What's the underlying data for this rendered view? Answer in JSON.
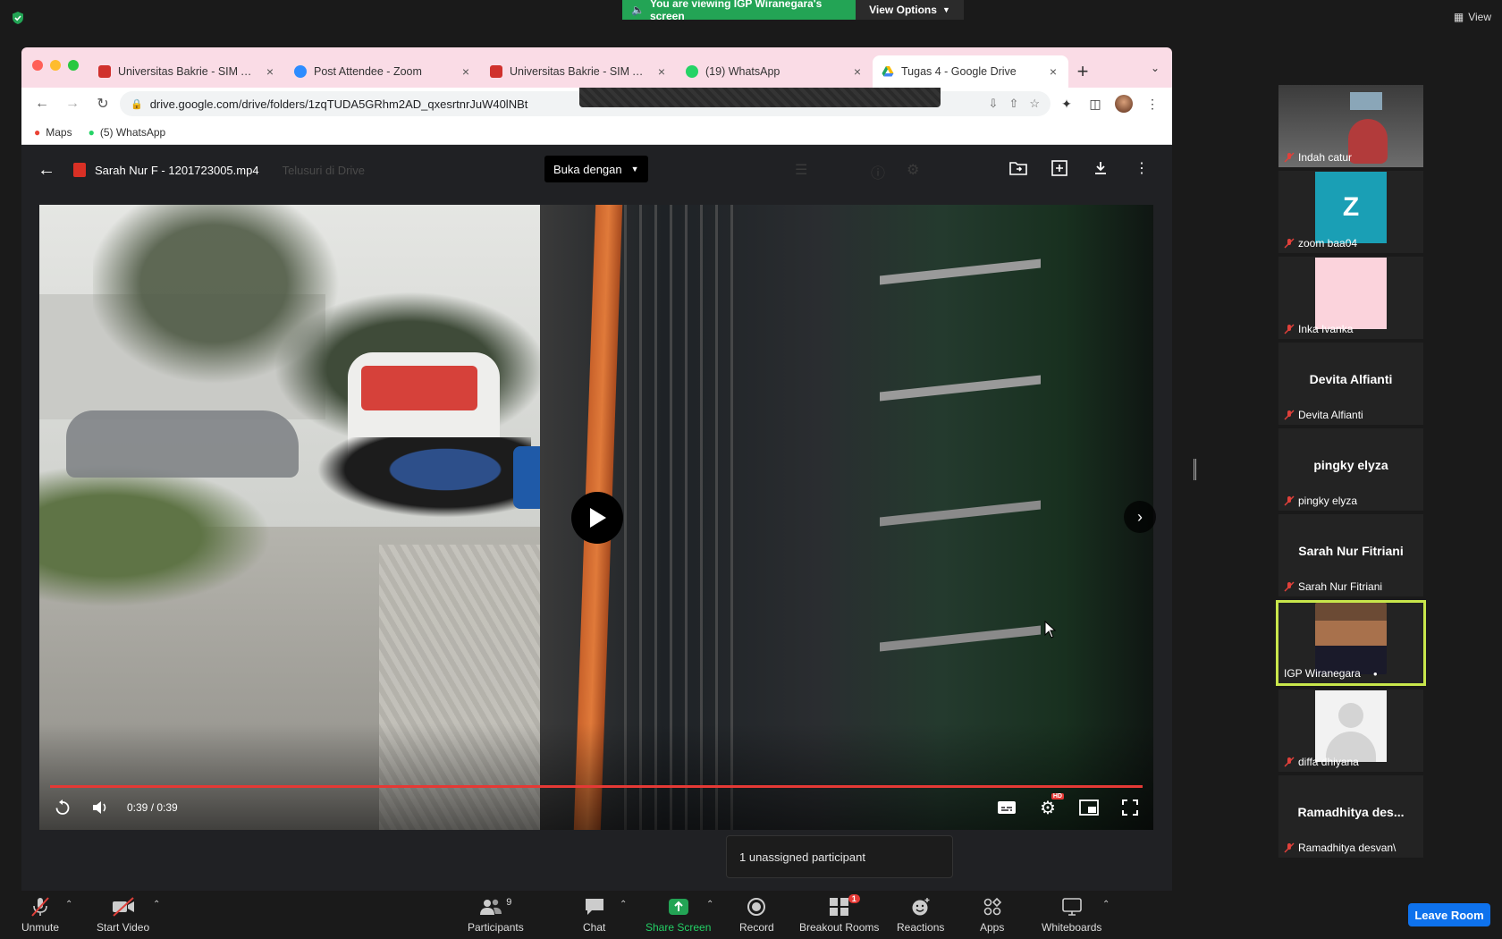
{
  "zoom_top": {
    "viewing_text": "You are viewing IGP Wiranegara's screen",
    "view_options": "View Options",
    "view_label": "View"
  },
  "chrome": {
    "tabs": [
      {
        "label": "Universitas Bakrie - SIM Akad",
        "favicon_color": "#d0312d",
        "active": false
      },
      {
        "label": "Post Attendee - Zoom",
        "favicon_color": "#2d8cff",
        "active": false
      },
      {
        "label": "Universitas Bakrie - SIM Akad",
        "favicon_color": "#d0312d",
        "active": false
      },
      {
        "label": "(19) WhatsApp",
        "favicon_color": "#25d366",
        "active": false
      },
      {
        "label": "Tugas 4 - Google Drive",
        "favicon_color": "#1fa463",
        "active": true
      }
    ],
    "url": "drive.google.com/drive/folders/1zqTUDA5GRhm2AD_qxesrtnrJuW40lNBt",
    "bookmarks": [
      {
        "label": "Maps"
      },
      {
        "label": "(5) WhatsApp"
      }
    ]
  },
  "drive": {
    "file_name": "Sarah Nur F - 1201723005.mp4",
    "ghost_search": "Telusuri di Drive",
    "open_with": "Buka dengan",
    "time": "0:39 / 0:39",
    "progress_fraction": 1.0
  },
  "unassigned": "1 unassigned participant",
  "participants": [
    {
      "name": "Indah catur",
      "type": "video"
    },
    {
      "name": "zoom baa04",
      "type": "letter",
      "letter": "Z",
      "color": "#1a9fb5"
    },
    {
      "name": "Inka Ivanka",
      "type": "pink"
    },
    {
      "name": "Devita Alfianti",
      "display": "Devita Alfianti",
      "type": "name"
    },
    {
      "name": "pingky elyza",
      "display": "pingky elyza",
      "type": "name"
    },
    {
      "name": "Sarah Nur Fitriani",
      "display": "Sarah Nur Fitriani",
      "type": "name"
    },
    {
      "name": "IGP Wiranegara",
      "type": "photo",
      "active": true
    },
    {
      "name": "diffa dhiyana",
      "type": "avatar"
    },
    {
      "name": "Ramadhitya desvan\\",
      "display": "Ramadhitya  des...",
      "type": "name"
    }
  ],
  "bottom_bar": {
    "unmute": "Unmute",
    "start_video": "Start Video",
    "participants": "Participants",
    "participants_count": "9",
    "chat": "Chat",
    "share_screen": "Share Screen",
    "record": "Record",
    "breakout_rooms": "Breakout Rooms",
    "breakout_badge": "1",
    "reactions": "Reactions",
    "apps": "Apps",
    "whiteboards": "Whiteboards",
    "leave_room": "Leave Room"
  },
  "colors": {
    "zoom_green": "#23a455",
    "leave_blue": "#0e72ed",
    "active_border": "#c8e64b",
    "progress_red": "#e53935"
  }
}
